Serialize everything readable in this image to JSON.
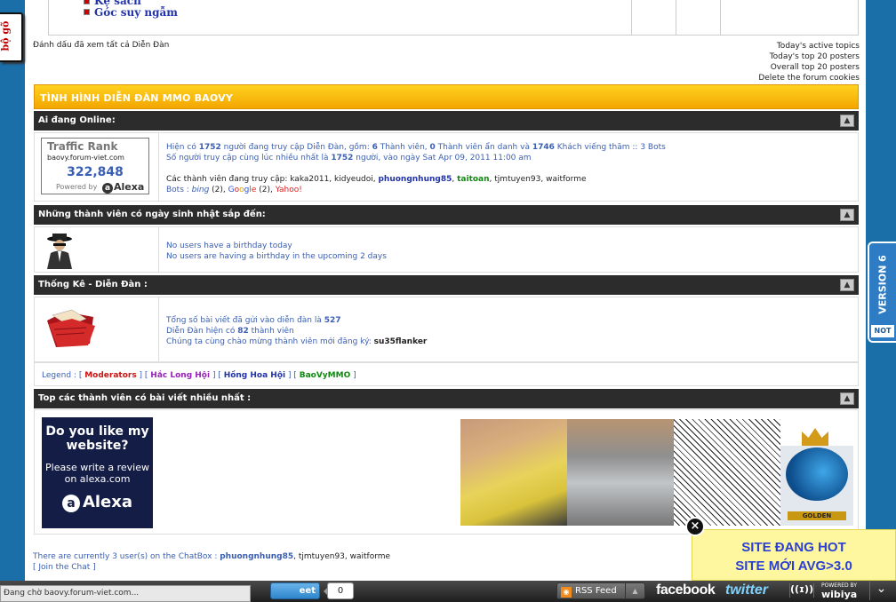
{
  "left_tab": {
    "label": "bộ gõ"
  },
  "top_fragment": {
    "item0": "Kệ sách",
    "item1": "Góc suy ngẫm"
  },
  "mark_read": "Đánh dấu đã xem tất cả Diễn Đàn",
  "right_links": [
    "Today's active topics",
    "Today's top 20 posters",
    "Overall top 20 posters",
    "Delete the forum cookies"
  ],
  "forum_title": "TÌNH HÌNH DIỄN ĐÀN MMO BAOVY",
  "online": {
    "header": "Ai đang Online:",
    "traffic_rank_title": "Traffic Rank",
    "traffic_site": "baovy.forum-viet.com",
    "traffic_value": "322,848",
    "traffic_powered": "Powered by",
    "traffic_alexa": "Alexa",
    "line1_a": "Hiện có ",
    "line1_n1": "1752",
    "line1_b": " người đang truy cập Diễn Đàn, gồm: ",
    "line1_n2": "6",
    "line1_c": " Thành viên, ",
    "line1_n3": "0",
    "line1_d": " Thành viên ẩn danh và ",
    "line1_n4": "1746",
    "line1_e": " Khách viếng thăm :: 3 Bots",
    "line2_a": "Số người truy cập cùng lúc nhiều nhất là ",
    "line2_n": "1752",
    "line2_b": " người, vào ngày Sat Apr 09, 2011 11:00 am",
    "users_label": "Các thành viên đang truy cập: ",
    "users": [
      {
        "name": "kaka2011",
        "sep": ", ",
        "color": "#222222",
        "bold": false
      },
      {
        "name": "kidyeudoi",
        "sep": ", ",
        "color": "#222222",
        "bold": false
      },
      {
        "name": "phuongnhung85",
        "sep": ", ",
        "color": "#2233aa",
        "bold": true
      },
      {
        "name": "taitoan",
        "sep": ", ",
        "color": "#118811",
        "bold": true
      },
      {
        "name": "tjmtuyen93",
        "sep": ", ",
        "color": "#222222",
        "bold": false
      },
      {
        "name": "waitforme",
        "sep": "",
        "color": "#222222",
        "bold": false
      }
    ],
    "bots_label": "Bots : ",
    "bot1": "bing",
    "bot1_count": " (2), ",
    "bot2_g": "G",
    "bot2_o1": "o",
    "bot2_o2": "o",
    "bot2_g2": "g",
    "bot2_l": "l",
    "bot2_e": "e",
    "bot2_count": " (2), ",
    "bot3": "Yahoo!"
  },
  "birthday": {
    "header": "Những thành viên có ngày sinh nhật sắp đến:",
    "line1": "No users have a birthday today",
    "line2": "No users are having a birthday in the upcoming 2 days"
  },
  "stats": {
    "header": "Thống Kê - Diễn Đàn :",
    "line1_a": "Tổng số bài viết đã gửi vào diễn đàn là ",
    "line1_n": "527",
    "line2_a": "Diễn Đàn hiện có ",
    "line2_n": "82",
    "line2_b": " thành viên",
    "line3_a": "Chúng ta cùng chào mừng thành viên mới đăng ký: ",
    "line3_user": "su35flanker"
  },
  "legend": {
    "label": "Legend : ",
    "items": [
      {
        "name": "Moderators",
        "color": "#cc1111"
      },
      {
        "name": "Hắc Long Hội",
        "color": "#9922bb"
      },
      {
        "name": "Hồng Hoa Hội",
        "color": "#2233aa"
      },
      {
        "name": "BaoVyMMO",
        "color": "#118811"
      }
    ]
  },
  "top_posters": {
    "header": "Top các thành viên có bài viết nhiều nhất :",
    "ad_question": "Do you like my website?",
    "ad_write": "Please write a review on alexa.com",
    "ad_logo": "Alexa",
    "avatar4_text": "GOLDEN"
  },
  "chatbox": {
    "a": "There are currently 3 user(s) on the ChatBox : ",
    "u1": "phuongnhung85",
    "u2": "tjmtuyen93",
    "u3": "waitforme",
    "join": "[ Join the Chat ]"
  },
  "version_tab": {
    "label": "VERSION 6",
    "sub": "NOT"
  },
  "promo": {
    "line1": "SITE ĐANG HOT",
    "line2": "SITE MỚI AVG>3.0"
  },
  "status_bar": "Đang chờ baovy.forum-viet.com...",
  "bottom": {
    "tweet_label": "eet",
    "tweet_count": "0",
    "rss_label": "RSS Feed",
    "facebook": "facebook",
    "twitter": "twitter",
    "wibiya_powered": "POWERED BY",
    "wibiya_name": "wibiya"
  }
}
